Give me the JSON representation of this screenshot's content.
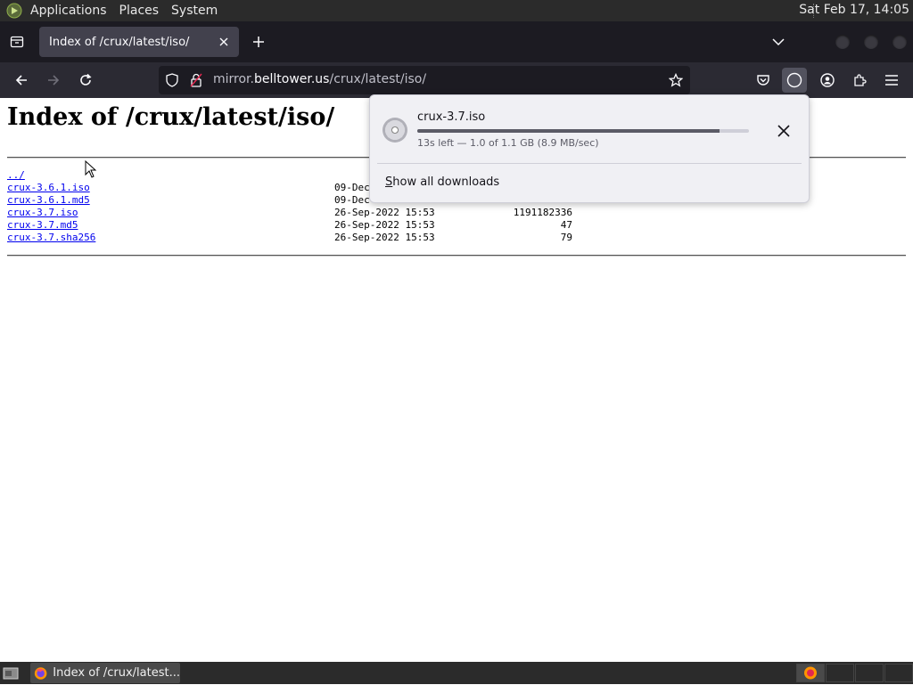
{
  "system_panel": {
    "menus": [
      "Applications",
      "Places",
      "System"
    ],
    "clock": "Sat Feb 17, 14:05"
  },
  "browser": {
    "tab": {
      "title": "Index of /crux/latest/iso/"
    },
    "url": {
      "prefix": "mirror.",
      "domain": "belltower.us",
      "path": "/crux/latest/iso/"
    }
  },
  "page": {
    "heading": "Index of /crux/latest/iso/",
    "entries": [
      {
        "name": "../",
        "date": "",
        "size": ""
      },
      {
        "name": "crux-3.6.1.iso",
        "date": "09-Dec",
        "size": ""
      },
      {
        "name": "crux-3.6.1.md5",
        "date": "09-Dec",
        "size": ""
      },
      {
        "name": "crux-3.7.iso",
        "date": "26-Sep-2022 15:53",
        "size": "1191182336"
      },
      {
        "name": "crux-3.7.md5",
        "date": "26-Sep-2022 15:53",
        "size": "47"
      },
      {
        "name": "crux-3.7.sha256",
        "date": "26-Sep-2022 15:53",
        "size": "79"
      }
    ]
  },
  "downloads_panel": {
    "file_name": "crux-3.7.iso",
    "status": "13s left — 1.0 of 1.1 GB (8.9 MB/sec)",
    "progress_percent": 91,
    "show_all_label": "Show all downloads",
    "show_all_accesskey": "S",
    "show_all_rest": "how all downloads"
  },
  "taskbar": {
    "task_label": "Index of /crux/latest..."
  },
  "colors": {
    "link": "#0000ee",
    "toolbar_dark": "#2b2a33",
    "tabbar_dark": "#1c1b22",
    "panel_bg": "#f0f0f4"
  }
}
